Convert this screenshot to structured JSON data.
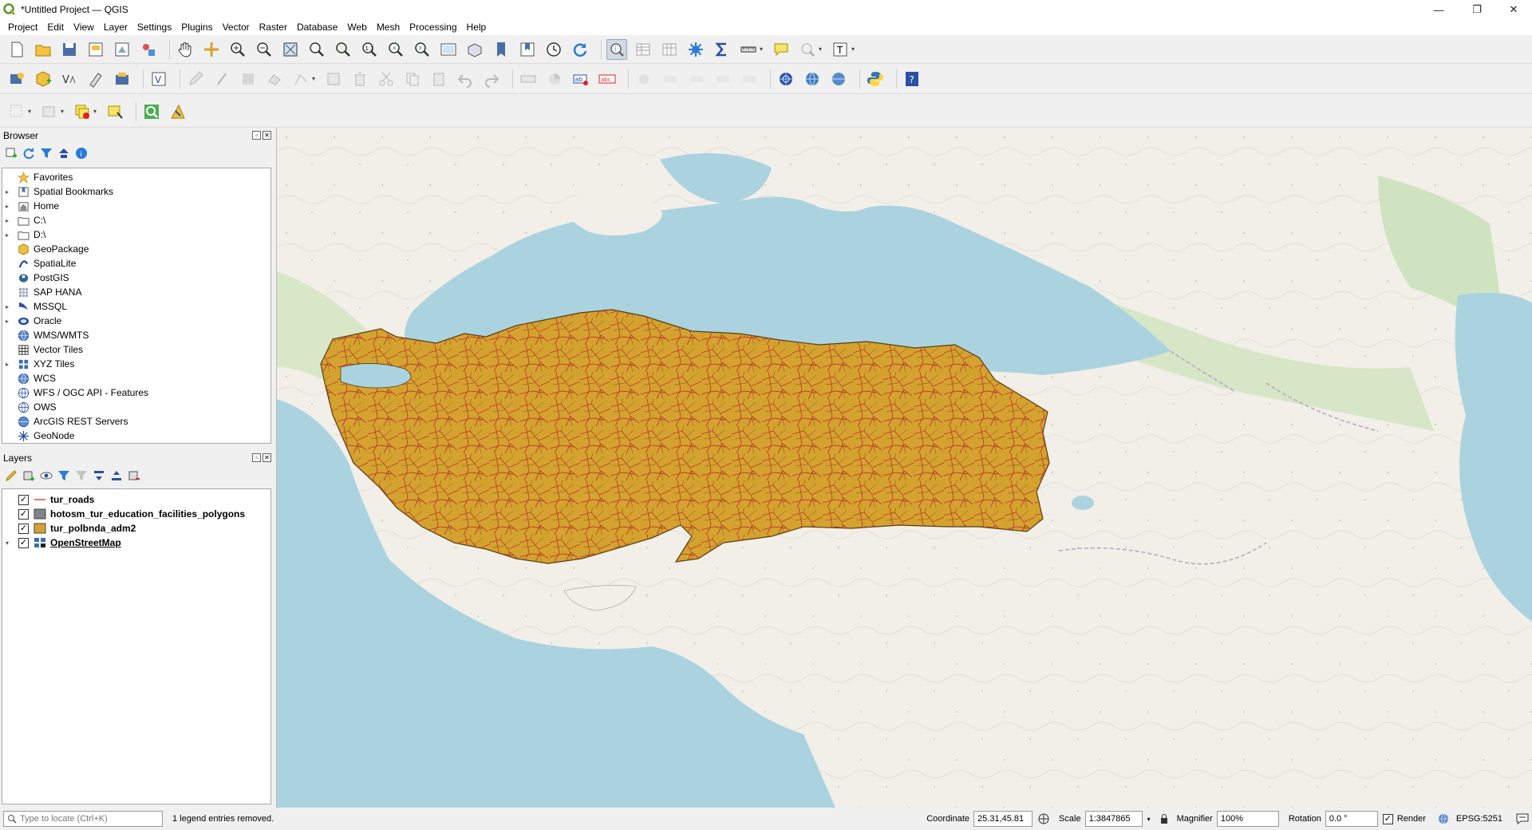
{
  "window": {
    "title": "*Untitled Project — QGIS"
  },
  "menu": [
    "Project",
    "Edit",
    "View",
    "Layer",
    "Settings",
    "Plugins",
    "Vector",
    "Raster",
    "Database",
    "Web",
    "Mesh",
    "Processing",
    "Help"
  ],
  "browser": {
    "title": "Browser",
    "items": [
      {
        "label": "Favorites",
        "icon": "star-icon",
        "arrow": ""
      },
      {
        "label": "Spatial Bookmarks",
        "icon": "bookmark-icon",
        "arrow": "▸"
      },
      {
        "label": "Home",
        "icon": "home-folder-icon",
        "arrow": "▸"
      },
      {
        "label": "C:\\",
        "icon": "drive-icon",
        "arrow": "▸"
      },
      {
        "label": "D:\\",
        "icon": "drive-icon",
        "arrow": "▸"
      },
      {
        "label": "GeoPackage",
        "icon": "geopackage-icon",
        "arrow": ""
      },
      {
        "label": "SpatiaLite",
        "icon": "spatialite-icon",
        "arrow": ""
      },
      {
        "label": "PostGIS",
        "icon": "postgis-icon",
        "arrow": ""
      },
      {
        "label": "SAP HANA",
        "icon": "sap-hana-icon",
        "arrow": ""
      },
      {
        "label": "MSSQL",
        "icon": "mssql-icon",
        "arrow": "▸"
      },
      {
        "label": "Oracle",
        "icon": "oracle-icon",
        "arrow": "▸"
      },
      {
        "label": "WMS/WMTS",
        "icon": "globe-icon",
        "arrow": ""
      },
      {
        "label": "Vector Tiles",
        "icon": "grid-icon",
        "arrow": ""
      },
      {
        "label": "XYZ Tiles",
        "icon": "tiles-icon",
        "arrow": "▸"
      },
      {
        "label": "WCS",
        "icon": "globe-icon",
        "arrow": ""
      },
      {
        "label": "WFS / OGC API - Features",
        "icon": "globe-icon",
        "arrow": ""
      },
      {
        "label": "OWS",
        "icon": "globe-icon",
        "arrow": ""
      },
      {
        "label": "ArcGIS REST Servers",
        "icon": "globe-icon",
        "arrow": ""
      },
      {
        "label": "GeoNode",
        "icon": "geonode-icon",
        "arrow": ""
      }
    ]
  },
  "layers": {
    "title": "Layers",
    "items": [
      {
        "label": "tur_roads",
        "legend": "line",
        "color": "#c8503c",
        "checked": "✓",
        "arrow": ""
      },
      {
        "label": "hotosm_tur_education_facilities_polygons",
        "legend": "fill",
        "color": "#7d8587",
        "checked": "✓",
        "arrow": ""
      },
      {
        "label": "tur_polbnda_adm2",
        "legend": "fill",
        "color": "#d4a32f",
        "checked": "✓",
        "arrow": ""
      },
      {
        "label": "OpenStreetMap",
        "legend": "raster",
        "color": "#3a6fb0",
        "checked": "✓",
        "arrow": "▾"
      }
    ]
  },
  "map": {
    "sea_color": "#aad3df",
    "land_color": "#f2efe9",
    "country_fill": "#d4a32f",
    "road_color": "#c23a2a"
  },
  "status": {
    "locator_placeholder": "Type to locate (Ctrl+K)",
    "message": "1 legend entries removed.",
    "coordinate_label": "Coordinate",
    "coordinate": "25.31,45.81",
    "scale_label": "Scale",
    "scale": "1:3847865",
    "magnifier_label": "Magnifier",
    "magnifier": "100%",
    "rotation_label": "Rotation",
    "rotation": "0.0 °",
    "render_label": "Render",
    "crs": "EPSG:5251"
  }
}
